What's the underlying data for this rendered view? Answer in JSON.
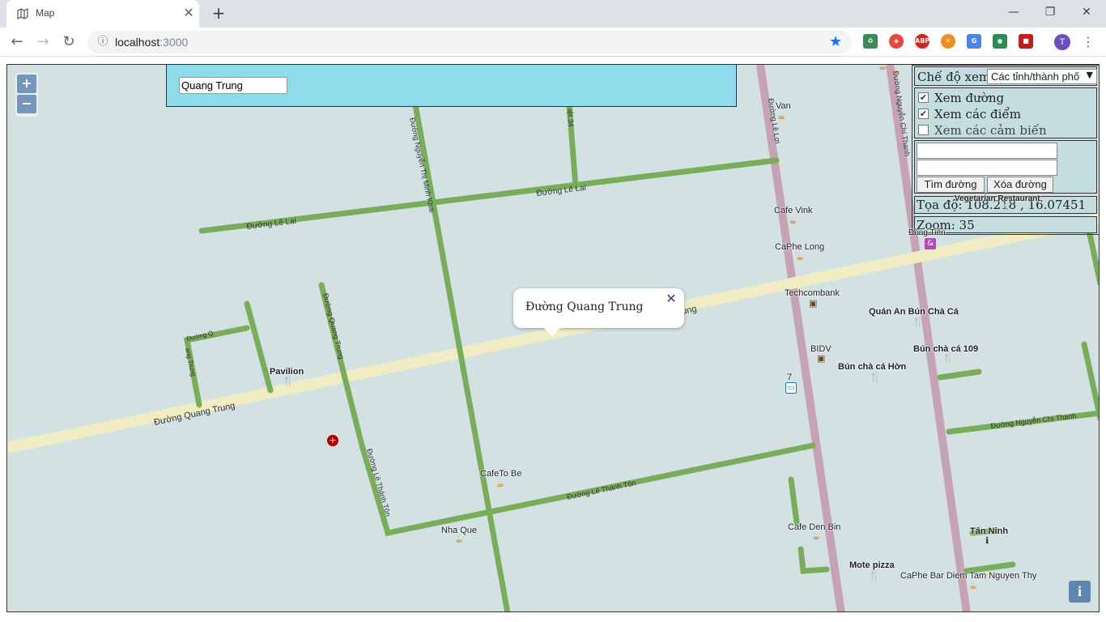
{
  "browser": {
    "tab_title": "Map",
    "tab_close": "✕",
    "new_tab": "+",
    "url_host": "localhost",
    "url_port": ":3000",
    "avatar_letter": "T",
    "win_min": "—",
    "win_max": "❐",
    "win_close": "✕",
    "back": "←",
    "forward": "→",
    "reload": "↻",
    "info": "ⓘ",
    "star": "★",
    "menu": "⋮"
  },
  "search": {
    "value": "Quang Trung"
  },
  "zoom_control": {
    "in": "+",
    "out": "−"
  },
  "panel": {
    "mode_label": "Chế độ xem:",
    "mode_value": "Các tỉnh/thành phố",
    "layers": [
      {
        "label": "Xem đường",
        "checked": true
      },
      {
        "label": "Xem các điểm",
        "checked": true
      },
      {
        "label": "Xem các cảm biến",
        "checked": false
      }
    ],
    "find_button": "Tìm đường",
    "clear_button": "Xóa đường",
    "coord_text": "Tọa độ: 108.218 , 16.07451",
    "zoom_text": "Zoom: 35"
  },
  "popup": {
    "text": "Đường Quang Trung",
    "close": "✕"
  },
  "info_button": "i",
  "roads": {
    "le_lai_1": "Đường Lê Lai",
    "le_lai_2": "Đường Lê Lai",
    "quang_trung": "Đường Quang Trung",
    "quang_trung_2": "ung",
    "nguyen_thi_minh_khai": "Đường Nguyễn Thị Minh Khai",
    "quang_trung_v": "Đường Quang Trung",
    "le_thanh_ton_v": "Đường Lê Thánh Tôn",
    "le_thanh_ton_h": "Đường Lê Thánh Tôn",
    "le_loi": "Đường Lê Lợi",
    "nguyen_chi_thanh_v": "Đường Nguyễn Chí Thanh",
    "nguyen_chi_thanh_h": "Đường Nguyễn Chí Thanh",
    "road_34": "iệt 34",
    "small_a": "Đường Q",
    "small_b": "ang Trung"
  },
  "pois": {
    "van": "Van",
    "cafe_vink": "Cafe Vink",
    "caphe_long": "CaPhe Long",
    "techcombank": "Techcombank",
    "quan_an": "Quán An Bún Chà Cá",
    "bidv": "BIDV",
    "bun_cha_109": "Bún chà cá 109",
    "bun_cha_hon": "Bún chà cá Hờn",
    "pavilion": "Pavilion",
    "cafeto_be": "CafeTo Be",
    "nha_que": "Nha Que",
    "cafe_den_bin": "Cafe Den Bin",
    "tan_ninh": "Tấn Ninh",
    "mote_pizza": "Mote pizza",
    "caphe_bar": "CaPhe  Bar Diem Tam Nguyen Thy",
    "vegetarian": "Vegetarian Restaurant",
    "dong_tien": "Đồng Tiến",
    "bus_7": "7"
  }
}
